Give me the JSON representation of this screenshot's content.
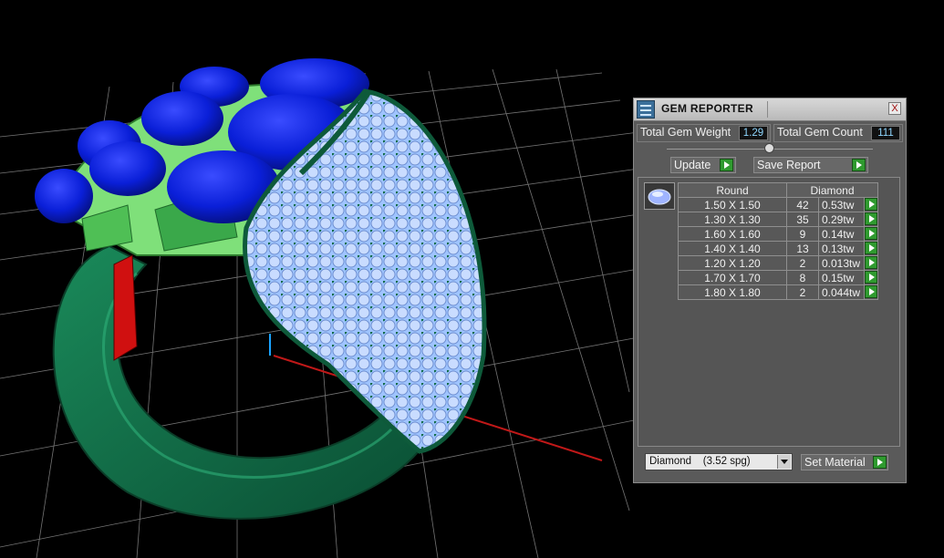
{
  "panel": {
    "title": "GEM REPORTER",
    "close_label": "X"
  },
  "totals": {
    "weight_label": "Total Gem Weight",
    "weight_value": "1.29",
    "count_label": "Total Gem Count",
    "count_value": "111"
  },
  "buttons": {
    "update_label": "Update",
    "save_report_label": "Save Report",
    "set_material_label": "Set Material"
  },
  "table": {
    "headers": [
      "Round",
      "Diamond"
    ],
    "rows": [
      {
        "size": "1.50 X 1.50",
        "count": "42",
        "weight": "0.53tw"
      },
      {
        "size": "1.30 X 1.30",
        "count": "35",
        "weight": "0.29tw"
      },
      {
        "size": "1.60 X 1.60",
        "count": "9",
        "weight": "0.14tw"
      },
      {
        "size": "1.40 X 1.40",
        "count": "13",
        "weight": "0.13tw"
      },
      {
        "size": "1.20 X 1.20",
        "count": "2",
        "weight": "0.013tw"
      },
      {
        "size": "1.70 X 1.70",
        "count": "8",
        "weight": "0.15tw"
      },
      {
        "size": "1.80 X 1.80",
        "count": "2",
        "weight": "0.044tw"
      }
    ]
  },
  "material": {
    "selected": "Diamond    (3.52 spg)"
  },
  "icons": {
    "app": "gem-reporter-icon",
    "close": "close-icon",
    "go": "play-arrow-icon",
    "dropdown": "chevron-down-icon",
    "gem": "round-gem-icon"
  },
  "colors": {
    "gem_blue": "#0a1fd8",
    "metal_green": "#0f6a45",
    "diamond_light": "#9fc4ff",
    "accent_green_button": "#2f9a2f",
    "value_text": "#8fd7ff"
  }
}
